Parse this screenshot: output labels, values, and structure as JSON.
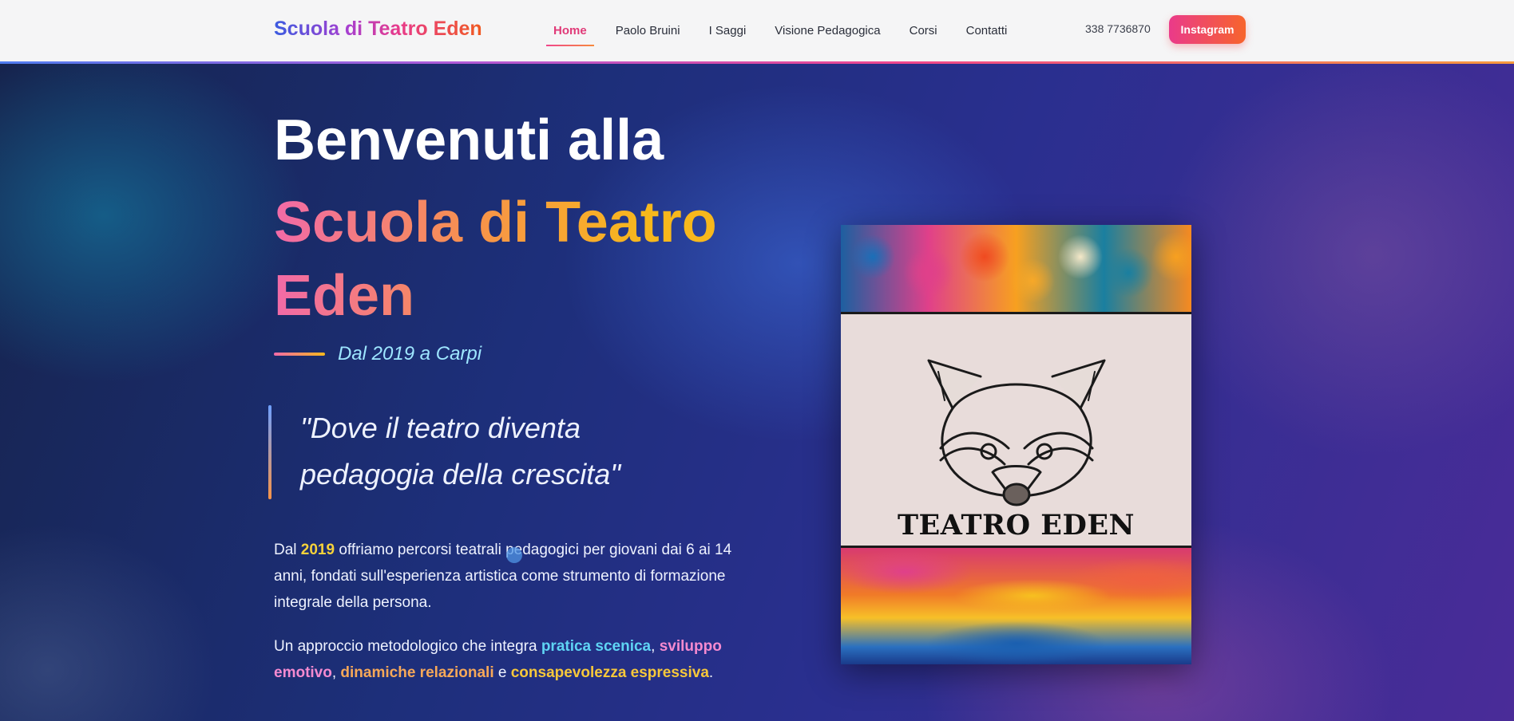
{
  "nav": {
    "brand": "Scuola di Teatro Eden",
    "items": [
      "Home",
      "Paolo Bruini",
      "I Saggi",
      "Visione Pedagogica",
      "Corsi",
      "Contatti"
    ],
    "active_item": "Home",
    "phone": "338 7736870",
    "instagram_label": "Instagram"
  },
  "hero": {
    "title_line1": "Benvenuti alla",
    "title_line2": "Scuola di Teatro Eden",
    "subtitle": "Dal 2019 a Carpi",
    "quote": "\"Dove il teatro diventa pedagogia della crescita\"",
    "p1": {
      "before": "Dal ",
      "year": "2019",
      "after": " offriamo percorsi teatrali pedagogici per giovani dai 6 ai 14 anni, fondati sull'esperienza artistica come strumento di formazione integrale della persona."
    },
    "p2": {
      "before": "Un approccio metodologico che integra ",
      "h1": "pratica scenica",
      "sep1": ", ",
      "h2": "sviluppo emotivo",
      "sep2": ", ",
      "h3": "dinamiche relazionali",
      "sep3": " e ",
      "h4": "consapevolezza espressiva",
      "end": "."
    }
  },
  "poster": {
    "title": "TEATRO EDEN",
    "icon": "raccoon-icon"
  },
  "colors": {
    "accent_pink": "#ea3a8a",
    "accent_orange": "#f7642c",
    "highlight_yellow": "#f7d23a",
    "highlight_cyan": "#5fd4f4"
  }
}
